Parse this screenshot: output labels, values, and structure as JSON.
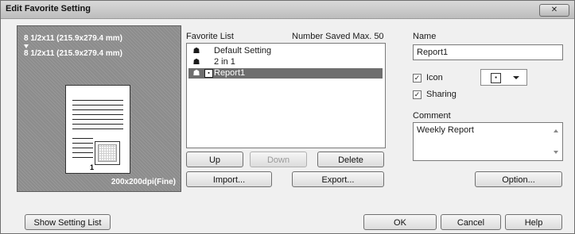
{
  "window": {
    "title": "Edit Favorite Setting",
    "close_icon": "close-icon"
  },
  "preview": {
    "paper_primary": "8 1/2x11 (215.9x279.4 mm)",
    "paper_secondary": "8 1/2x11 (215.9x279.4 mm)",
    "resolution": "200x200dpi(Fine)",
    "page_number": "1"
  },
  "favorites": {
    "list_label": "Favorite List",
    "capacity_label": "Number Saved Max. 50",
    "items": [
      {
        "label": "Default Setting",
        "icon": "people-icon",
        "selected": false
      },
      {
        "label": "2 in 1",
        "icon": "people-icon",
        "selected": false
      },
      {
        "label": "Report1",
        "icon": "people-icon",
        "extra_icon": "page-icon",
        "selected": true
      }
    ],
    "buttons": {
      "up": "Up",
      "down": "Down",
      "delete": "Delete",
      "import": "Import...",
      "export": "Export..."
    }
  },
  "form": {
    "name_label": "Name",
    "name_value": "Report1",
    "icon_label": "Icon",
    "icon_checked": true,
    "sharing_label": "Sharing",
    "sharing_checked": true,
    "comment_label": "Comment",
    "comment_value": "Weekly Report",
    "option_button": "Option..."
  },
  "footer": {
    "show_setting_list": "Show Setting List",
    "ok": "OK",
    "cancel": "Cancel",
    "help": "Help"
  }
}
